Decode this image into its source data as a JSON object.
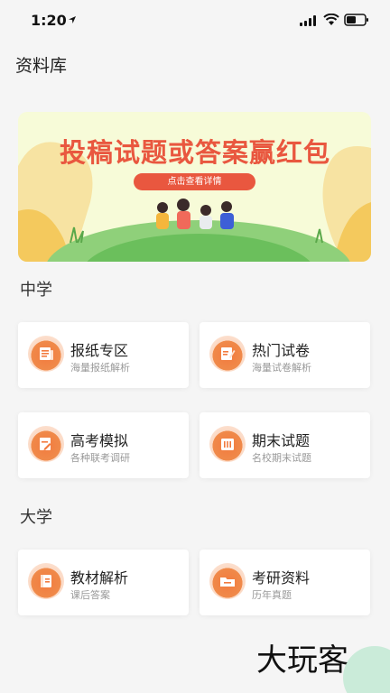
{
  "status": {
    "time": "1:20"
  },
  "header": {
    "title": "资料库"
  },
  "banner": {
    "title": "投稿试题或答案赢红包",
    "button": "点击查看详情"
  },
  "sections": [
    {
      "title": "中学",
      "cards": [
        {
          "title": "报纸专区",
          "subtitle": "海量报纸解析",
          "icon": "newspaper-icon"
        },
        {
          "title": "热门试卷",
          "subtitle": "海量试卷解析",
          "icon": "edit-paper-icon"
        },
        {
          "title": "高考模拟",
          "subtitle": "各种联考调研",
          "icon": "pen-doc-icon"
        },
        {
          "title": "期末试题",
          "subtitle": "名校期末试题",
          "icon": "exam-icon"
        }
      ]
    },
    {
      "title": "大学",
      "cards": [
        {
          "title": "教材解析",
          "subtitle": "课后答案",
          "icon": "book-icon"
        },
        {
          "title": "考研资料",
          "subtitle": "历年真题",
          "icon": "folder-icon"
        }
      ]
    }
  ],
  "watermark": "大玩客",
  "colors": {
    "accent": "#e9573f",
    "icon": "#f27a3e",
    "background": "#f5f5f5"
  }
}
